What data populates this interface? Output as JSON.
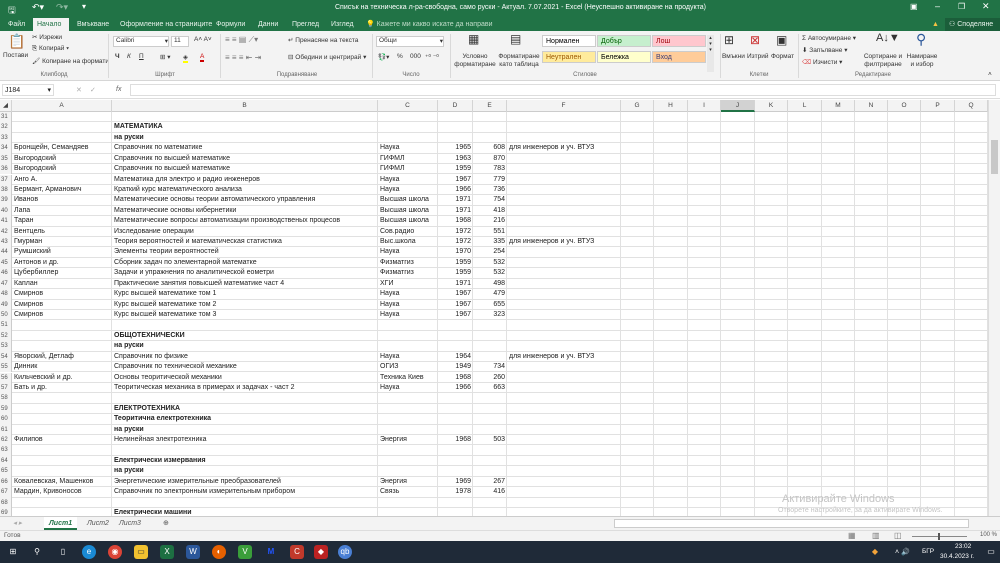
{
  "titlebar": {
    "title": "Списък на техническа л-ра-свободна, само руски - Актуал. 7.07.2021 - Excel (Неуспешно активиране на продукта)"
  },
  "menu": {
    "tabs": [
      "Файл",
      "Начало",
      "Вмъкване",
      "Оформление на страниците",
      "Формули",
      "Данни",
      "Преглед",
      "Изглед"
    ],
    "tell_me": "Кажете ми какво искате да направи",
    "share": "Споделяне"
  },
  "ribbon": {
    "clipboard": {
      "paste": "Постави",
      "cut": "Изрежи",
      "copy": "Копирай",
      "format_painter": "Копиране на формати",
      "group": "Клипборд"
    },
    "font": {
      "name": "Calibri",
      "size": "11",
      "bold": "Ч",
      "italic": "К",
      "underline": "П",
      "group": "Шрифт"
    },
    "alignment": {
      "wrap": "Пренасяне на текста",
      "merge": "Обедини и центрирай",
      "group": "Подравняване"
    },
    "number": {
      "format": "Общи",
      "percent": "%",
      "thousands": "000",
      "group": "Число"
    },
    "styles": {
      "conditional": "Условно форматиране",
      "table": "Форматиране като таблица",
      "items": [
        {
          "label": "Нормален",
          "bg": "#ffffff",
          "fg": "#000000"
        },
        {
          "label": "Добър",
          "bg": "#c6efce",
          "fg": "#006100"
        },
        {
          "label": "Лош",
          "bg": "#ffc7ce",
          "fg": "#9c0006"
        },
        {
          "label": "Неутрален",
          "bg": "#ffeb9c",
          "fg": "#9c5700"
        },
        {
          "label": "Бележка",
          "bg": "#ffffcc",
          "fg": "#000000"
        },
        {
          "label": "Вход",
          "bg": "#ffcc99",
          "fg": "#3f3f76"
        }
      ],
      "group": "Стилове"
    },
    "cells": {
      "insert": "Вмъкни",
      "delete": "Изтрий",
      "format": "Формат",
      "group": "Клетки"
    },
    "editing": {
      "autosum": "Автосумиране",
      "fill": "Запълване",
      "clear": "Изчисти",
      "sort": "Сортиране и филтриране",
      "find": "Намиране и избор",
      "group": "Редактиране"
    }
  },
  "formula": {
    "namebox": "J184",
    "fx": "fx",
    "value": ""
  },
  "columns": [
    "A",
    "B",
    "C",
    "D",
    "E",
    "F",
    "G",
    "H",
    "I",
    "J",
    "K",
    "L",
    "M",
    "N",
    "O",
    "P",
    "Q"
  ],
  "selected_column": "J",
  "rows": [
    {
      "n": "31"
    },
    {
      "n": "32",
      "B": "МАТЕМАТИКА",
      "bold": true
    },
    {
      "n": "33",
      "B": "на руски",
      "bold": true
    },
    {
      "n": "34",
      "A": "Бронщейн, Семандяев",
      "B": "Справочник по математике",
      "C": "Наука",
      "D": "1965",
      "E": "608",
      "F": "для инженеров и уч. ВТУЗ"
    },
    {
      "n": "35",
      "A": "Выгородский",
      "B": "Справочник по высшей математике",
      "C": "ГИФМЛ",
      "D": "1963",
      "E": "870"
    },
    {
      "n": "36",
      "A": "Выгородский",
      "B": "Справочник по высшей математике",
      "C": "ГИФМЛ",
      "D": "1959",
      "E": "783"
    },
    {
      "n": "37",
      "A": "Анго А.",
      "B": "Математика для электро и радио инженеров",
      "C": "Наука",
      "D": "1967",
      "E": "779"
    },
    {
      "n": "38",
      "A": "Бермант, Арманович",
      "B": "Краткий курс математического анализа",
      "C": "Наука",
      "D": "1966",
      "E": "736"
    },
    {
      "n": "39",
      "A": "Иванов",
      "B": "Математические основы теории автоматического управления",
      "C": "Высшая школа",
      "D": "1971",
      "E": "754"
    },
    {
      "n": "40",
      "A": "Лапа",
      "B": "Математические основы кибернетики",
      "C": "Высшая школа",
      "D": "1971",
      "E": "418"
    },
    {
      "n": "41",
      "A": "Таран",
      "B": "Математические вопросы автоматизации производственых процесов",
      "C": "Высшая школа",
      "D": "1968",
      "E": "216"
    },
    {
      "n": "42",
      "A": "Вентцель",
      "B": "Изследование операции",
      "C": "Сов.радио",
      "D": "1972",
      "E": "551"
    },
    {
      "n": "43",
      "A": "Гмурман",
      "B": "Теория вероятностей и математическая статистика",
      "C": "Выс.школа",
      "D": "1972",
      "E": "335",
      "F": "для инженеров и уч. ВТУЗ"
    },
    {
      "n": "44",
      "A": "Румшиский",
      "B": "Элементы теории вероятностей",
      "C": "Наука",
      "D": "1970",
      "E": "254"
    },
    {
      "n": "45",
      "A": "Антонов и др.",
      "B": "Сборник задач по элементарной математке",
      "C": "Физматгиз",
      "D": "1959",
      "E": "532"
    },
    {
      "n": "46",
      "A": "Цубербиллер",
      "B": "Задачи и упражнения по аналитической еометри",
      "C": "Физматгиз",
      "D": "1959",
      "E": "532"
    },
    {
      "n": "47",
      "A": "Каплан",
      "B": "Практические занятия повысшей математике част 4",
      "C": "ХГИ",
      "D": "1971",
      "E": "498"
    },
    {
      "n": "48",
      "A": "Смирнов",
      "B": "Курс высшей математике том 1",
      "C": "Наука",
      "D": "1967",
      "E": "479"
    },
    {
      "n": "49",
      "A": "Смирнов",
      "B": "Курс высшей математике том 2",
      "C": "Наука",
      "D": "1967",
      "E": "655"
    },
    {
      "n": "50",
      "A": "Смирнов",
      "B": "Курс высшей математике том 3",
      "C": "Наука",
      "D": "1967",
      "E": "323"
    },
    {
      "n": "51"
    },
    {
      "n": "52",
      "B": "ОБЩОТЕХНИЧЕСКИ",
      "bold": true
    },
    {
      "n": "53",
      "B": "на руски",
      "bold": true
    },
    {
      "n": "54",
      "A": "Яворский, Детлаф",
      "B": "Справочник по физике",
      "C": "Наука",
      "D": "1964",
      "F": "для инженеров и уч. ВТУЗ"
    },
    {
      "n": "55",
      "A": "Динник",
      "B": "Справочник по технической механике",
      "C": "ОГИЗ",
      "D": "1949",
      "E": "734"
    },
    {
      "n": "56",
      "A": "Кильчевский и др.",
      "B": "Основы теоритической механики",
      "C": "Техника Киев",
      "D": "1968",
      "E": "260"
    },
    {
      "n": "57",
      "A": "Бать и др.",
      "B": "Теоритическая механика в примерах и задачах - част 2",
      "C": "Наука",
      "D": "1966",
      "E": "663"
    },
    {
      "n": "58"
    },
    {
      "n": "59",
      "B": "ЕЛЕКТРОТЕХНИКА",
      "bold": true
    },
    {
      "n": "60",
      "B": "Теоритична електротехника",
      "bold": true
    },
    {
      "n": "61",
      "B": "на руски",
      "bold": true
    },
    {
      "n": "62",
      "A": "Филипов",
      "B": "Нелинейная электротехника",
      "C": "Энергия",
      "D": "1968",
      "E": "503"
    },
    {
      "n": "63"
    },
    {
      "n": "64",
      "B": "Електрически измервания",
      "bold": true
    },
    {
      "n": "65",
      "B": "на руски",
      "bold": true
    },
    {
      "n": "66",
      "A": "Ковалевская, Машенков",
      "B": "Энергетические измерительные преобразователей",
      "C": "Энергия",
      "D": "1969",
      "E": "267"
    },
    {
      "n": "67",
      "A": "Мардин, Кривоносов",
      "B": "Справочник по электронным измерительным прибором",
      "C": "Связь",
      "D": "1978",
      "E": "416"
    },
    {
      "n": "68"
    },
    {
      "n": "69",
      "B": "Електрически машини",
      "bold": true
    }
  ],
  "sheets": {
    "tabs": [
      "Лист1",
      "Лист2",
      "Лист3"
    ],
    "active": "Лист1"
  },
  "status": {
    "ready": "Готов",
    "zoom": "100 %"
  },
  "watermark": {
    "title": "Активирайте Windows",
    "subtitle": "Отворете настройките, за да активирате Windows."
  },
  "taskbar": {
    "lang": "БГР",
    "time": "23:02",
    "date": "30.4.2023 г."
  },
  "colors": {
    "excel_green": "#217346",
    "taskbar": "#1f2a38"
  }
}
